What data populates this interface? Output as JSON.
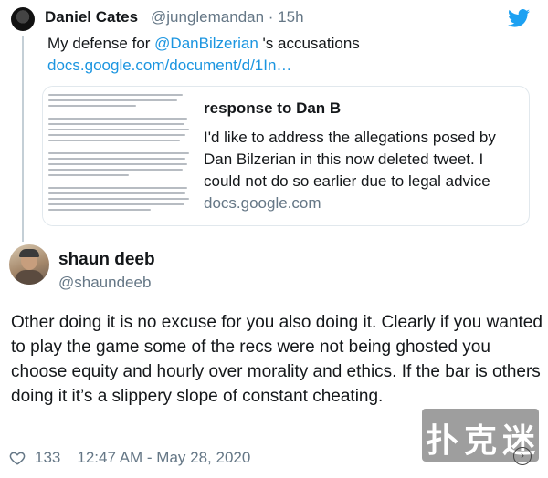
{
  "quoted_tweet": {
    "author_name": "Daniel Cates",
    "author_handle": "@junglemandan · 15h",
    "text_prefix": "My defense for ",
    "mention": "@DanBilzerian",
    "text_suffix": " 's accusations",
    "link": "docs.google.com/document/d/1In…",
    "card": {
      "title": "response to Dan B",
      "description": "I'd like to address the allegations posed by Dan Bilzerian in this now deleted tweet. I could not do so earlier due to legal advice",
      "domain": "docs.google.com"
    }
  },
  "tweet": {
    "author_name": "shaun deeb",
    "author_handle": "@shaundeeb",
    "text": "Other doing it is no excuse for you also doing it. Clearly if you wanted to play the game some of the recs were not being ghosted you choose equity and hourly over morality and ethics. If the bar is others doing it it’s a slippery slope of constant cheating.",
    "likes": "133",
    "timestamp": "12:47 AM - May 28, 2020"
  },
  "watermark": {
    "chars": [
      "扑",
      "克",
      "迷"
    ]
  },
  "colors": {
    "link_blue": "#1b95e0",
    "twitter_blue": "#1da1f2",
    "secondary_text": "#657786"
  },
  "icons": {
    "brand": "twitter-bird-icon",
    "like": "heart-icon",
    "info": "chevron-icon"
  }
}
